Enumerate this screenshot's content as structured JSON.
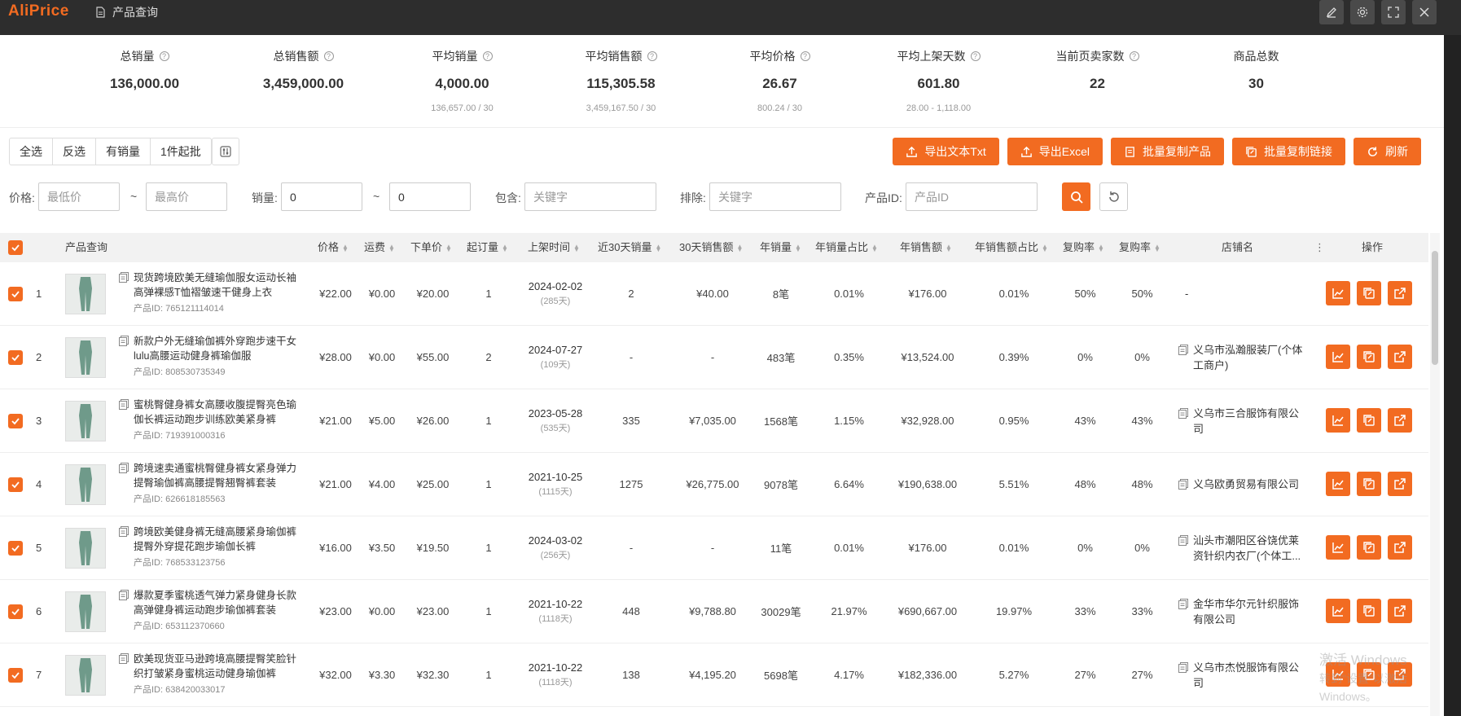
{
  "app": {
    "logo": "AliPrice",
    "title": "产品查询"
  },
  "stats": [
    {
      "label": "总销量",
      "value": "136,000.00",
      "sub": "",
      "help": true
    },
    {
      "label": "总销售额",
      "value": "3,459,000.00",
      "sub": "",
      "help": true
    },
    {
      "label": "平均销量",
      "value": "4,000.00",
      "sub": "136,657.00 / 30",
      "help": true
    },
    {
      "label": "平均销售额",
      "value": "115,305.58",
      "sub": "3,459,167.50 / 30",
      "help": true
    },
    {
      "label": "平均价格",
      "value": "26.67",
      "sub": "800.24 / 30",
      "help": true
    },
    {
      "label": "平均上架天数",
      "value": "601.80",
      "sub": "28.00 - 1,118.00",
      "help": true
    },
    {
      "label": "当前页卖家数",
      "value": "22",
      "sub": "",
      "help": true
    },
    {
      "label": "商品总数",
      "value": "30",
      "sub": "",
      "help": false
    }
  ],
  "toolbar": {
    "select_all": "全选",
    "invert": "反选",
    "has_sales": "有销量",
    "one_piece": "1件起批",
    "export_txt": "导出文本Txt",
    "export_excel": "导出Excel",
    "copy_products": "批量复制产品",
    "copy_links": "批量复制链接",
    "refresh": "刷新"
  },
  "filters": {
    "price_label": "价格:",
    "price_min_ph": "最低价",
    "price_max_ph": "最高价",
    "sales_label": "销量:",
    "sales_min": "0",
    "sales_max": "0",
    "include_label": "包含:",
    "include_ph": "关键字",
    "exclude_label": "排除:",
    "exclude_ph": "关键字",
    "pid_label": "产品ID:",
    "pid_ph": "产品ID",
    "tilde": "~"
  },
  "table": {
    "headers": {
      "product": "产品查询",
      "price": "价格",
      "shipping": "运费",
      "unit": "下单价",
      "moq": "起订量",
      "listed": "上架时间",
      "sales30": "近30天销量",
      "rev30": "30天销售额",
      "ysales": "年销量",
      "yshare": "年销量占比",
      "yrev": "年销售额",
      "yrevshare": "年销售额占比",
      "rep1": "复购率",
      "rep2": "复购率",
      "store": "店铺名",
      "ops": "操作"
    },
    "id_prefix": "产品ID: ",
    "rows": [
      {
        "n": "1",
        "name": "现货跨境欧美无缝瑜伽服女运动长袖高弹裸感T恤褶皱速干健身上衣",
        "id": "765121114014",
        "price": "¥22.00",
        "ship": "¥0.00",
        "unit": "¥20.00",
        "moq": "1",
        "date": "2024-02-02",
        "days": "(285天)",
        "s30": "2",
        "r30": "¥40.00",
        "ys": "8笔",
        "ysh": "0.01%",
        "yr": "¥176.00",
        "yrs": "0.01%",
        "rp1": "50%",
        "rp2": "50%",
        "store": "-",
        "store_icon": false
      },
      {
        "n": "2",
        "name": "新款户外无缝瑜伽裤外穿跑步速干女lulu高腰运动健身裤瑜伽服",
        "id": "808530735349",
        "price": "¥28.00",
        "ship": "¥0.00",
        "unit": "¥55.00",
        "moq": "2",
        "date": "2024-07-27",
        "days": "(109天)",
        "s30": "-",
        "r30": "-",
        "ys": "483笔",
        "ysh": "0.35%",
        "yr": "¥13,524.00",
        "yrs": "0.39%",
        "rp1": "0%",
        "rp2": "0%",
        "store": "义乌市泓瀚服装厂(个体工商户)",
        "store_icon": true
      },
      {
        "n": "3",
        "name": "蜜桃臀健身裤女高腰收腹提臀亮色瑜伽长裤运动跑步训练欧美紧身裤",
        "id": "719391000316",
        "price": "¥21.00",
        "ship": "¥5.00",
        "unit": "¥26.00",
        "moq": "1",
        "date": "2023-05-28",
        "days": "(535天)",
        "s30": "335",
        "r30": "¥7,035.00",
        "ys": "1568笔",
        "ysh": "1.15%",
        "yr": "¥32,928.00",
        "yrs": "0.95%",
        "rp1": "43%",
        "rp2": "43%",
        "store": "义乌市三合服饰有限公司",
        "store_icon": true
      },
      {
        "n": "4",
        "name": "跨境速卖通蜜桃臀健身裤女紧身弹力提臀瑜伽裤高腰提臀翘臀裤套装",
        "id": "626618185563",
        "price": "¥21.00",
        "ship": "¥4.00",
        "unit": "¥25.00",
        "moq": "1",
        "date": "2021-10-25",
        "days": "(1115天)",
        "s30": "1275",
        "r30": "¥26,775.00",
        "ys": "9078笔",
        "ysh": "6.64%",
        "yr": "¥190,638.00",
        "yrs": "5.51%",
        "rp1": "48%",
        "rp2": "48%",
        "store": "义乌欧勇贸易有限公司",
        "store_icon": true
      },
      {
        "n": "5",
        "name": "跨境欧美健身裤无缝高腰紧身瑜伽裤提臀外穿提花跑步瑜伽长裤",
        "id": "768533123756",
        "price": "¥16.00",
        "ship": "¥3.50",
        "unit": "¥19.50",
        "moq": "1",
        "date": "2024-03-02",
        "days": "(256天)",
        "s30": "-",
        "r30": "-",
        "ys": "11笔",
        "ysh": "0.01%",
        "yr": "¥176.00",
        "yrs": "0.01%",
        "rp1": "0%",
        "rp2": "0%",
        "store": "汕头市潮阳区谷饶优莱资针织内衣厂(个体工...",
        "store_icon": true
      },
      {
        "n": "6",
        "name": "爆款夏季蜜桃透气弹力紧身健身长款高弹健身裤运动跑步瑜伽裤套装",
        "id": "653112370660",
        "price": "¥23.00",
        "ship": "¥0.00",
        "unit": "¥23.00",
        "moq": "1",
        "date": "2021-10-22",
        "days": "(1118天)",
        "s30": "448",
        "r30": "¥9,788.80",
        "ys": "30029笔",
        "ysh": "21.97%",
        "yr": "¥690,667.00",
        "yrs": "19.97%",
        "rp1": "33%",
        "rp2": "33%",
        "store": "金华市华尔元针织服饰有限公司",
        "store_icon": true
      },
      {
        "n": "7",
        "name": "欧美现货亚马逊跨境高腰提臀笑脸针织打皱紧身蜜桃运动健身瑜伽裤",
        "id": "638420033017",
        "price": "¥32.00",
        "ship": "¥3.30",
        "unit": "¥32.30",
        "moq": "1",
        "date": "2021-10-22",
        "days": "(1118天)",
        "s30": "138",
        "r30": "¥4,195.20",
        "ys": "5698笔",
        "ysh": "4.17%",
        "yr": "¥182,336.00",
        "yrs": "5.27%",
        "rp1": "27%",
        "rp2": "27%",
        "store": "义乌市杰悦服饰有限公司",
        "store_icon": true
      }
    ]
  },
  "watermark": {
    "line1": "激活 Windows",
    "line2": "转到\"设置\"以激活 Windows。"
  },
  "colors": {
    "accent": "#f26b21",
    "topbar": "#2d2d2d"
  }
}
